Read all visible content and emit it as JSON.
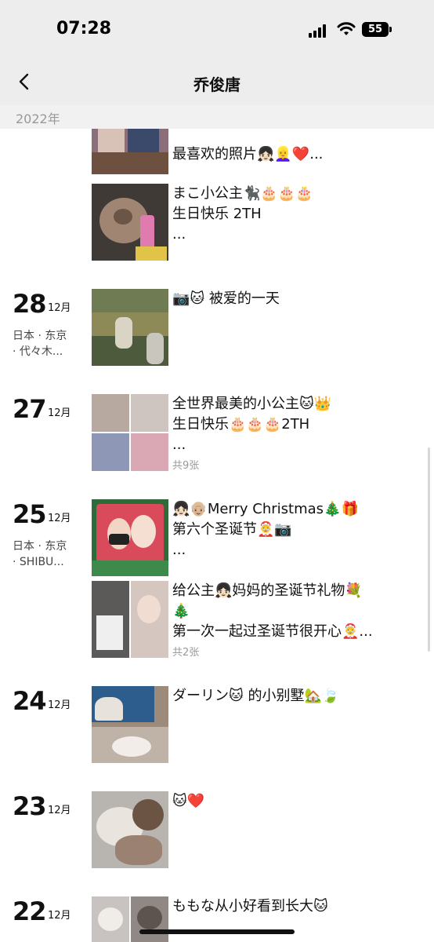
{
  "status": {
    "time": "07:28",
    "battery": "55"
  },
  "header": {
    "title": "乔俊唐",
    "back_icon": "chevron-left-icon"
  },
  "year": "2022年",
  "days": [
    {
      "day": "",
      "month": "",
      "location": "",
      "posts": [
        {
          "text": "最喜欢的照片👧🏻👱‍♀️❤️...",
          "count": "",
          "thumb": "photo"
        },
        {
          "text": "まこ小公主🐈‍⬛🎂🎂🎂\n生日快乐 2TH\n...",
          "count": "",
          "thumb": "photo"
        }
      ]
    },
    {
      "day": "28",
      "month": "12月",
      "location": "日本 · 东京\n· 代々木...",
      "posts": [
        {
          "text": "📷🐱 被爱的一天",
          "count": "",
          "thumb": "photo"
        }
      ]
    },
    {
      "day": "27",
      "month": "12月",
      "location": "",
      "posts": [
        {
          "text": "全世界最美的小公主🐱👑\n生日快乐🎂🎂🎂2TH\n...",
          "count": "共9张",
          "thumb": "grid"
        }
      ]
    },
    {
      "day": "25",
      "month": "12月",
      "location": "日本 · 东京\n· SHIBU...",
      "posts": [
        {
          "text": "👧🏻👴🏼Merry Christmas🎄🎁\n第六个圣诞节🤶📷\n...",
          "count": "",
          "thumb": "photo"
        },
        {
          "text": "给公主👧🏻妈妈的圣诞节礼物💐\n🎄\n第一次一起过圣诞节很开心🤶...",
          "count": "共2张",
          "thumb": "split"
        }
      ]
    },
    {
      "day": "24",
      "month": "12月",
      "location": "",
      "posts": [
        {
          "text": "ダーリン🐱 的小别墅🏡🍃",
          "count": "",
          "thumb": "photo"
        }
      ]
    },
    {
      "day": "23",
      "month": "12月",
      "location": "",
      "posts": [
        {
          "text": "🐱❤️",
          "count": "",
          "thumb": "photo"
        }
      ]
    },
    {
      "day": "22",
      "month": "12月",
      "location": "",
      "posts": [
        {
          "text": "ももな从小好看到长大🐱",
          "count": "",
          "thumb": "split"
        }
      ]
    }
  ],
  "colors": {
    "background": "#ffffff",
    "header": "#ededed",
    "year_bar": "#f1f1f1",
    "muted": "#999999"
  }
}
